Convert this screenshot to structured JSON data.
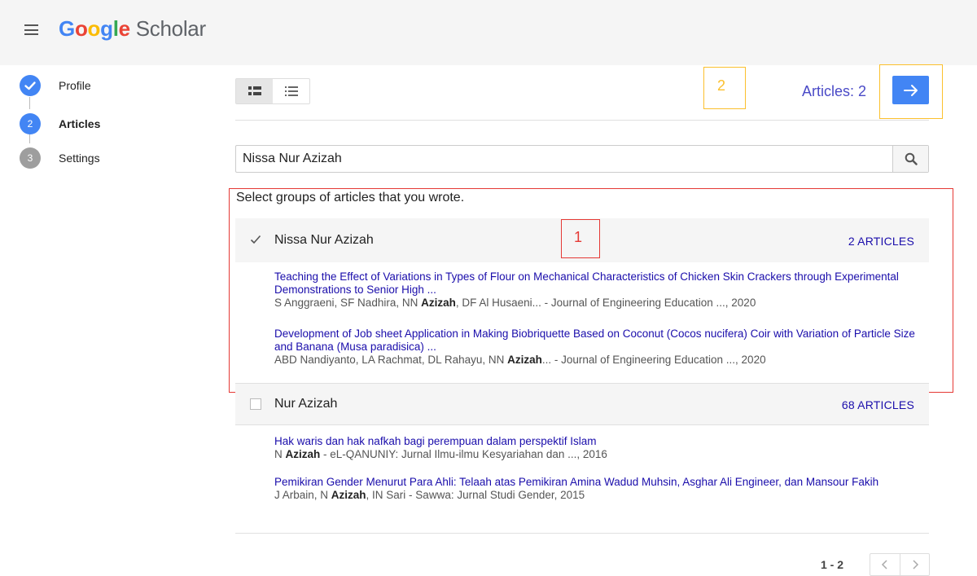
{
  "header": {
    "logo_google": "Google",
    "logo_scholar": "Scholar"
  },
  "stepper": {
    "steps": [
      {
        "label": "Profile",
        "state": "done"
      },
      {
        "label": "Articles",
        "state": "active",
        "number": "2"
      },
      {
        "label": "Settings",
        "state": "pending",
        "number": "3"
      }
    ]
  },
  "toolbar": {
    "articles_count": "Articles: 2"
  },
  "annotations": {
    "label_1": "1",
    "label_2": "2",
    "box_1_color": "#e53935",
    "box_2_color": "#fbc02d"
  },
  "search": {
    "value": "Nissa Nur Azizah"
  },
  "instructions": "Select groups of articles that you wrote.",
  "groups": [
    {
      "name": "Nissa Nur Azizah",
      "count": "2 ARTICLES",
      "checked": true,
      "articles": [
        {
          "title": "Teaching the Effect of Variations in Types of Flour on Mechanical Characteristics of Chicken Skin Crackers through Experimental Demonstrations to Senior High ...",
          "authors_pre": "S Anggraeni, SF Nadhira, NN ",
          "authors_bold": "Azizah",
          "authors_post": ", DF Al Husaeni... - Journal of Engineering Education ..., 2020"
        },
        {
          "title": "Development of Job sheet Application in Making Biobriquette Based on Coconut (Cocos nucifera) Coir with Variation of Particle Size and Banana (Musa paradisica) ...",
          "authors_pre": "ABD Nandiyanto, LA Rachmat, DL Rahayu, NN ",
          "authors_bold": "Azizah",
          "authors_post": "... - Journal of Engineering Education ..., 2020"
        }
      ]
    },
    {
      "name": "Nur Azizah",
      "count": "68 ARTICLES",
      "checked": false,
      "articles": [
        {
          "title": "Hak waris dan hak nafkah bagi perempuan dalam perspektif Islam",
          "authors_pre": "N ",
          "authors_bold": "Azizah",
          "authors_post": " - eL-QANUNIY: Jurnal Ilmu-ilmu Kesyariahan dan ..., 2016"
        },
        {
          "title": "Pemikiran Gender Menurut Para Ahli: Telaah atas Pemikiran Amina Wadud Muhsin, Asghar Ali Engineer, dan Mansour Fakih",
          "authors_pre": "J Arbain, N ",
          "authors_bold": "Azizah",
          "authors_post": ", IN Sari - Sawwa: Jurnal Studi Gender, 2015"
        }
      ]
    }
  ],
  "pagination": {
    "range": "1 - 2"
  },
  "colors": {
    "accent": "#4285f4",
    "link": "#1a0dab",
    "step_active": "#4285f4",
    "step_pending": "#9e9e9e"
  }
}
